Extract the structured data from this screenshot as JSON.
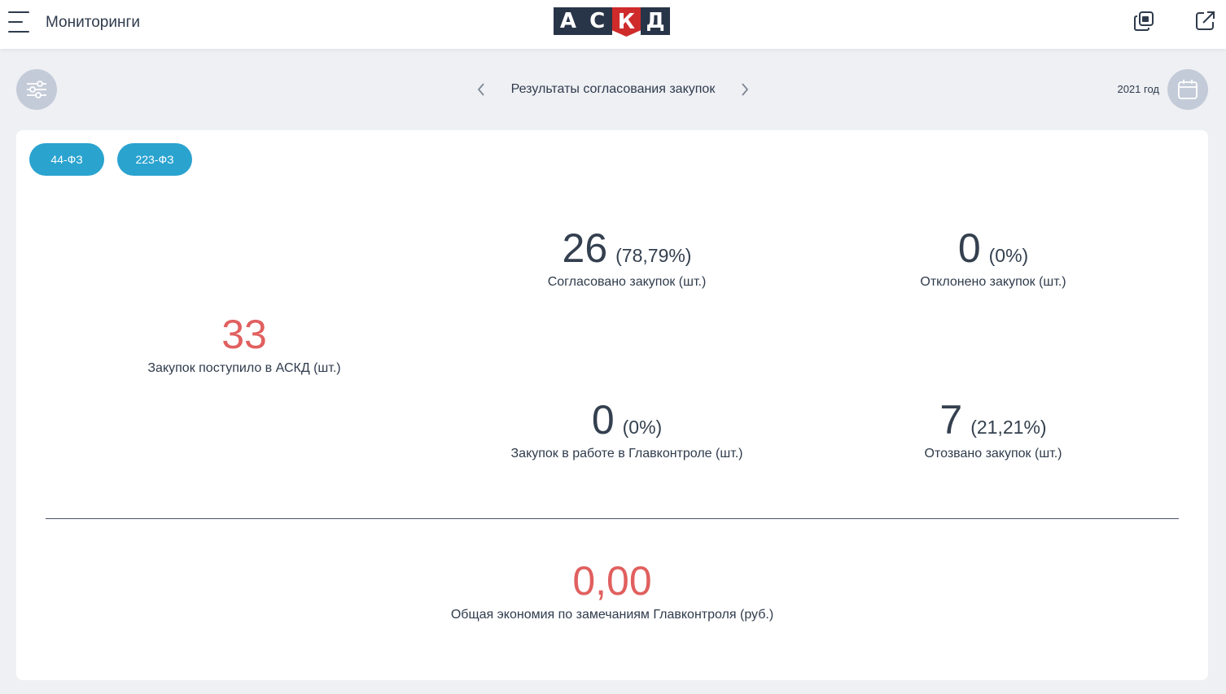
{
  "header": {
    "title": "Мониторинги",
    "logo_letters": [
      "А",
      "С",
      "К",
      "Д"
    ]
  },
  "toolbar": {
    "report_title": "Результаты согласования закупок",
    "year": "2021 год"
  },
  "tabs": [
    {
      "label": "44-ФЗ"
    },
    {
      "label": "223-ФЗ"
    }
  ],
  "metrics": {
    "received": {
      "value": "33",
      "caption": "Закупок поступило в АСКД (шт.)"
    },
    "approved": {
      "value": "26",
      "percent": "(78,79%)",
      "caption": "Согласовано закупок (шт.)"
    },
    "rejected": {
      "value": "0",
      "percent": "(0%)",
      "caption": "Отклонено закупок (шт.)"
    },
    "in_work": {
      "value": "0",
      "percent": "(0%)",
      "caption": "Закупок в работе в Главконтроле (шт.)"
    },
    "withdrawn": {
      "value": "7",
      "percent": "(21,21%)",
      "caption": "Отозвано закупок (шт.)"
    },
    "savings": {
      "value": "0,00",
      "caption": "Общая экономия по замечаниям Главконтроля (руб.)"
    }
  },
  "colors": {
    "accent": "#2aa3cf",
    "highlight_red": "#e0605f",
    "logo_dark": "#283447",
    "logo_red": "#cf2b2b",
    "icon_circle": "#c4cbd8"
  },
  "icons": {
    "menu": "hamburger-menu-icon",
    "copy": "copy-window-icon",
    "external": "open-external-icon",
    "filter": "sliders-filter-icon",
    "calendar": "calendar-icon",
    "prev": "chevron-left-icon",
    "next": "chevron-right-icon"
  }
}
